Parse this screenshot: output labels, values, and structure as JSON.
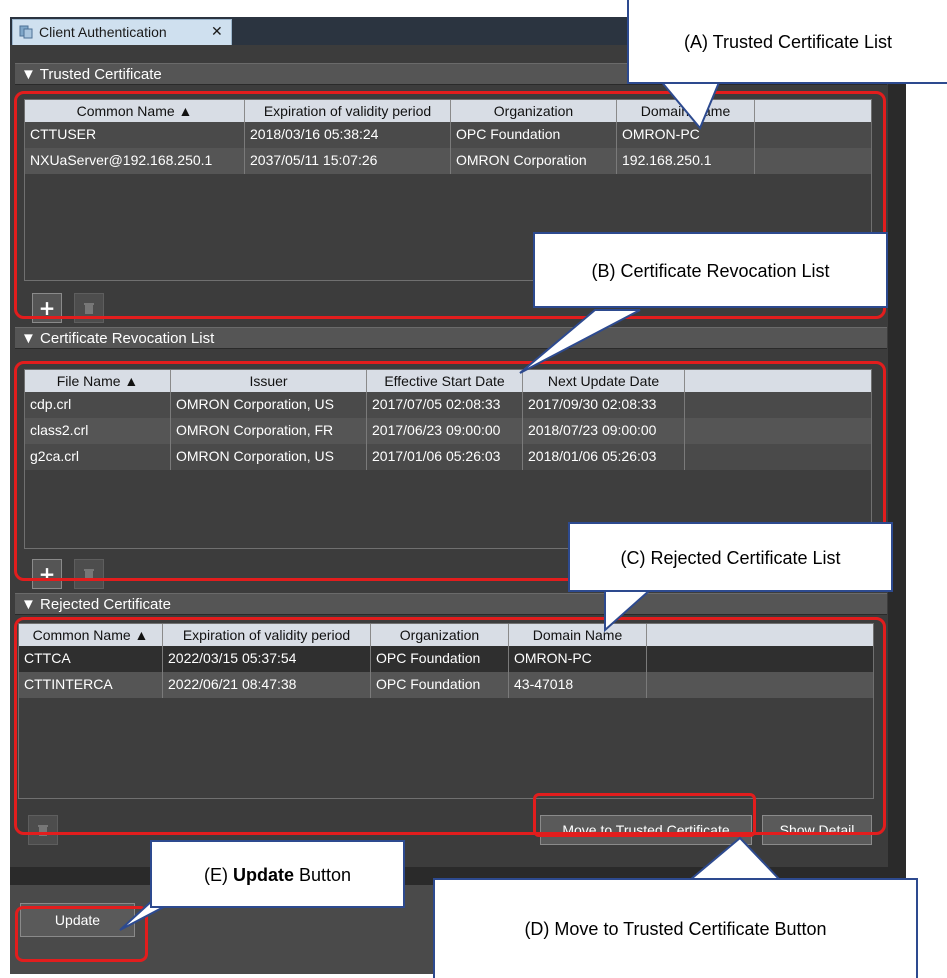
{
  "tab": {
    "title": "Client Authentication",
    "close_glyph": "✕",
    "icon": "document-icon"
  },
  "trusted": {
    "header": "▼ Trusted Certificate",
    "columns": [
      "Common Name ▲",
      "Expiration of validity period",
      "Organization",
      "Domain Name"
    ],
    "rows": [
      [
        "CTTUSER",
        "2018/03/16 05:38:24",
        "OPC Foundation",
        "OMRON-PC"
      ],
      [
        "NXUaServer@192.168.250.1",
        "2037/05/11 15:07:26",
        "OMRON Corporation",
        "192.168.250.1"
      ]
    ],
    "add_label": "+",
    "delete_icon": "trash-icon"
  },
  "revocation": {
    "header": "▼ Certificate Revocation List",
    "columns": [
      "File Name ▲",
      "Issuer",
      "Effective Start Date",
      "Next Update Date"
    ],
    "rows": [
      [
        "cdp.crl",
        "OMRON Corporation, US",
        "2017/07/05 02:08:33",
        "2017/09/30 02:08:33"
      ],
      [
        "class2.crl",
        "OMRON Corporation, FR",
        "2017/06/23 09:00:00",
        "2018/07/23 09:00:00"
      ],
      [
        "g2ca.crl",
        "OMRON Corporation, US",
        "2017/01/06 05:26:03",
        "2018/01/06 05:26:03"
      ]
    ],
    "add_label": "+",
    "delete_icon": "trash-icon"
  },
  "rejected": {
    "header": "▼ Rejected Certificate",
    "columns": [
      "Common Name ▲",
      "Expiration of validity period",
      "Organization",
      "Domain Name"
    ],
    "rows": [
      [
        "CTTCA",
        "2022/03/15 05:37:54",
        "OPC Foundation",
        "OMRON-PC"
      ],
      [
        "CTTINTERCA",
        "2022/06/21 08:47:38",
        "OPC Foundation",
        "43-47018"
      ]
    ],
    "delete_icon": "trash-icon",
    "move_label": "Move to Trusted Certificate",
    "detail_label": "Show Detail"
  },
  "update_label": "Update",
  "callouts": {
    "a": "(A) Trusted Certificate List",
    "b": "(B) Certificate Revocation List",
    "c": "(C) Rejected Certificate List",
    "d": "(D) Move to Trusted Certificate Button",
    "e_prefix": "(E) ",
    "e_bold": "Update",
    "e_suffix": " Button"
  },
  "colors": {
    "highlight": "#e21d1d",
    "callout_border": "#2d4a8f",
    "panel": "#3c3c3c"
  }
}
